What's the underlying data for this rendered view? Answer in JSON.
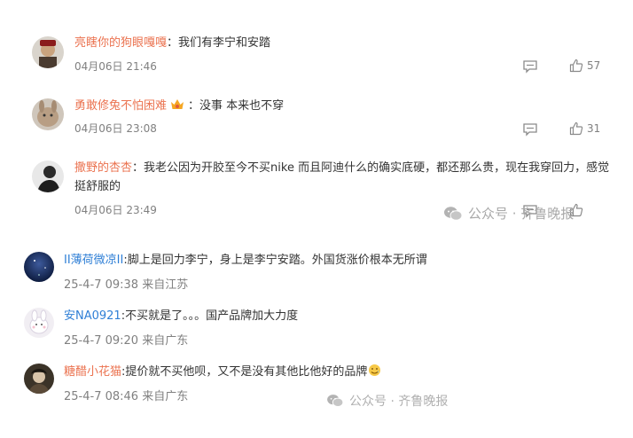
{
  "weibo_comments": [
    {
      "user": "亮瞎你的狗眼嘎嘎",
      "separator": "：",
      "text": "我们有李宁和安踏",
      "time": "04月06日 21:46",
      "likes": "57"
    },
    {
      "user": "勇敢修兔不怕困难",
      "separator": "：",
      "text": "没事 本来也不穿",
      "time": "04月06日 23:08",
      "likes": "31"
    },
    {
      "user": "撒野的杏杏",
      "separator": "：",
      "text_line1": "我老公因为开胶至今不买nike 而且阿迪什么的确实底硬，都还那么贵，现在我穿回力，感觉",
      "text_line2": "挺舒服的",
      "time": "04月06日 23:49",
      "likes": ""
    }
  ],
  "other_comments": [
    {
      "user": "II薄荷微凉II",
      "separator": ":",
      "text": "脚上是回力李宁，身上是李宁安踏。外国货涨价根本无所谓",
      "time": "25-4-7 09:38 来自江苏"
    },
    {
      "user": "安NA0921",
      "separator": ":",
      "text": "不买就是了。。。国产品牌加大力度",
      "time": "25-4-7 09:20 来自广东"
    },
    {
      "user": "糖醋小花猫",
      "separator": ":",
      "text": "提价就不买他呗，又不是没有其他比他好的品牌",
      "time": "25-4-7 08:46 来自广东"
    }
  ],
  "watermark": {
    "text": "公众号 · 齐鲁晚报",
    "icon": "wechat-icon"
  },
  "colors": {
    "username_orange": "#eb7350",
    "username_blue": "#2f7fd6",
    "meta_gray": "#808080"
  }
}
